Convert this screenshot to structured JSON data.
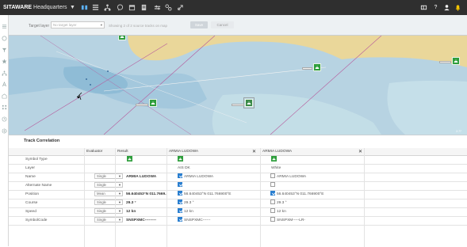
{
  "app": {
    "brand_bold": "SITAWARE",
    "brand_rest": "Headquarters"
  },
  "filterbar": {
    "target_label": "Target layer",
    "target_placeholder": "No target layer",
    "status": "Showing 2 of 2 source tracks on map",
    "save_label": "Save",
    "cancel_label": "Cancel"
  },
  "map": {
    "scale_label": "2.77"
  },
  "panel": {
    "title": "Track Correlation",
    "columns": {
      "attr": "",
      "evaluator": "Evaluator",
      "result": "Result",
      "source1": "ARMIA LUDOWA",
      "source2": "ARMIA LUDOWA"
    },
    "rows": [
      {
        "name": "Symbol Type",
        "evaluator": "",
        "result": "",
        "s1": "",
        "s2": "",
        "type": "symbol"
      },
      {
        "name": "Layer",
        "evaluator": "",
        "result": "",
        "s1": "AIS DK",
        "s2": "White",
        "type": "plain"
      },
      {
        "name": "Name",
        "evaluator": "Single",
        "result": "ARMIA LUDOWA",
        "s1": "ARMIA LUDOWA",
        "s2": "ARMIA LUDOWA",
        "s1_checked": true,
        "s2_checked": false,
        "type": "check"
      },
      {
        "name": "Alternate Name",
        "evaluator": "Single",
        "result": "",
        "s1": "",
        "s2": "",
        "s1_checked": true,
        "s2_checked": false,
        "type": "check"
      },
      {
        "name": "Position",
        "evaluator": "Mean",
        "result": "56.640453°N 011.7669...",
        "s1": "56.640453°N 011.766900°E",
        "s2": "56.640453°N 011.766900°E",
        "s1_checked": true,
        "s2_checked": true,
        "type": "check"
      },
      {
        "name": "Course",
        "evaluator": "Single",
        "result": "29.3 °",
        "s1": "29.3 °",
        "s2": "29.3 °",
        "s1_checked": true,
        "s2_checked": false,
        "type": "check"
      },
      {
        "name": "Speed",
        "evaluator": "Single",
        "result": "12 kn",
        "s1": "12 kn",
        "s2": "12 kn",
        "s1_checked": true,
        "s2_checked": false,
        "type": "check"
      },
      {
        "name": "SymbolCode",
        "evaluator": "Single",
        "result": "SNSPXMC---------",
        "s1": "SNSPXMC------",
        "s2": "SNSPXM-----LR-",
        "s1_checked": true,
        "s2_checked": false,
        "type": "check"
      }
    ]
  },
  "colors": {
    "topbar": "#2f2f2f",
    "accent_yellow": "#f5c400",
    "symbol_green": "#2e9e3c",
    "check_blue": "#2a7fd0"
  },
  "icons": {
    "topbar": [
      "chevron-down-icon",
      "grid-icon",
      "list-icon",
      "hierarchy-icon",
      "chat-icon",
      "calendar-icon",
      "document-icon",
      "tools-icon",
      "connections-icon",
      "share-icon"
    ],
    "topbar_right": [
      "panel-icon",
      "help-icon",
      "user-icon",
      "notification-icon"
    ],
    "rail": [
      "menu-icon",
      "layers-icon",
      "filter-icon",
      "star-icon",
      "network-icon",
      "text-icon",
      "building-icon",
      "tree-icon",
      "history-icon",
      "settings-icon"
    ]
  }
}
